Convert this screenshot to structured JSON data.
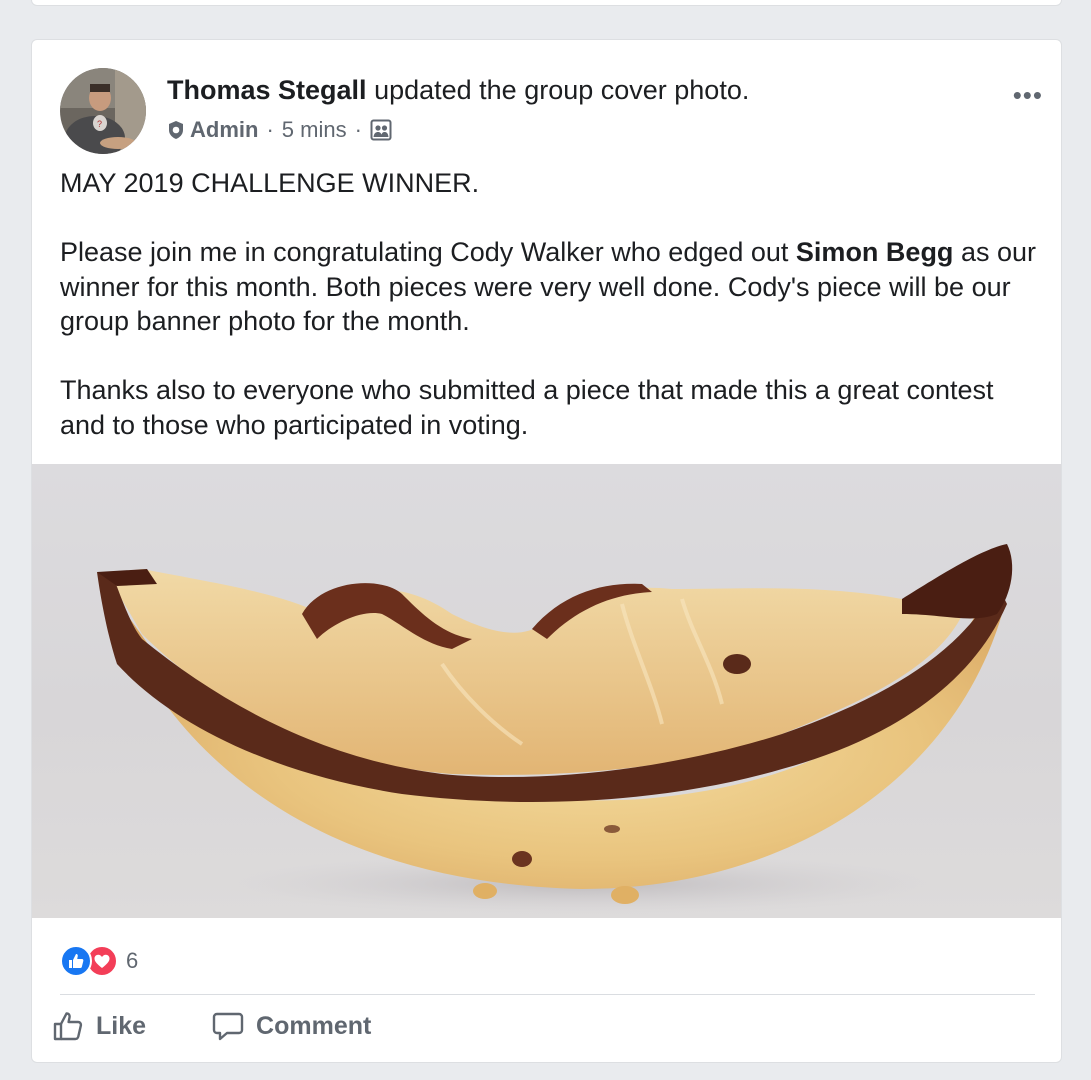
{
  "post": {
    "author": "Thomas Stegall",
    "action": "updated the group cover photo.",
    "role": "Admin",
    "time": "5 mins",
    "separator": "·",
    "more": "•••",
    "text": {
      "line1": "MAY 2019 CHALLENGE WINNER.",
      "para2_before": "Please join me in congratulating Cody Walker who edged out ",
      "para2_mention": "Simon Begg",
      "para2_after": " as our winner for this month.  Both pieces were very well done.  Cody's piece will be our group banner photo for the month.",
      "para3": "Thanks also to everyone who submitted a piece that made this a great contest and to those who participated in voting."
    },
    "reaction_count": "6",
    "actions": {
      "like": "Like",
      "comment": "Comment"
    }
  },
  "colors": {
    "like_blue": "#1877f2",
    "love_red": "#f33e58",
    "secondary_text": "#606770",
    "page_bg": "#e9ebee"
  },
  "icons": [
    "admin-shield-icon",
    "group-icon",
    "more-icon",
    "like-reaction-icon",
    "love-reaction-icon",
    "thumbs-up-icon",
    "comment-bubble-icon"
  ]
}
